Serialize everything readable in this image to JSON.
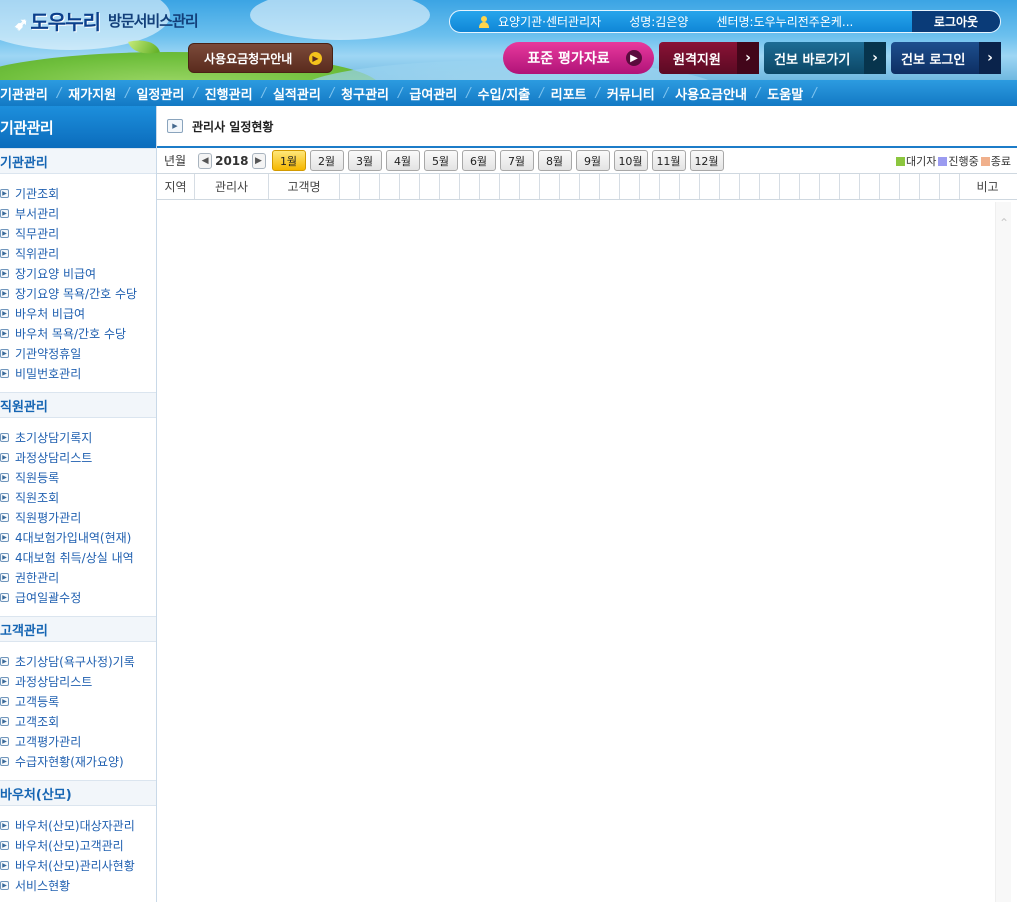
{
  "header": {
    "logo_text": "도우누리",
    "logo_sub": "방문서비스관리",
    "fee_guide_button": "사용요금청구안내",
    "user": {
      "org_type": "요양기관·센터관리자",
      "name_label": "성명:김은양",
      "center_label": "센터명:도우누리전주온케..."
    },
    "logout_label": "로그아웃",
    "standard_eval_button": "표준 평가자료",
    "remote_support_button": "원격지원",
    "health_insurance_button": "건보 바로가기",
    "health_login_button": "건보 로그인"
  },
  "nav": {
    "items": [
      "기관관리",
      "재가지원",
      "일정관리",
      "진행관리",
      "실적관리",
      "청구관리",
      "급여관리",
      "수입/지출",
      "리포트",
      "커뮤니티",
      "사용요금안내",
      "도움말"
    ]
  },
  "sidebar": {
    "title": "기관관리",
    "sections": [
      {
        "title": "기관관리",
        "items": [
          "기관조회",
          "부서관리",
          "직무관리",
          "직위관리",
          "장기요양 비급여",
          "장기요양 목욕/간호 수당",
          "바우처 비급여",
          "바우처 목욕/간호 수당",
          "기관약정휴일",
          "비밀번호관리"
        ]
      },
      {
        "title": "직원관리",
        "items": [
          "초기상담기록지",
          "과정상담리스트",
          "직원등록",
          "직원조회",
          "직원평가관리",
          "4대보험가입내역(현재)",
          "4대보험 취득/상실 내역",
          "권한관리",
          "급여일괄수정"
        ]
      },
      {
        "title": "고객관리",
        "items": [
          "초기상담(욕구사정)기록",
          "과정상담리스트",
          "고객등록",
          "고객조회",
          "고객평가관리",
          "수급자현황(재가요양)"
        ]
      },
      {
        "title": "바우처(산모)",
        "items": [
          "바우처(산모)대상자관리",
          "바우처(산모)고객관리",
          "바우처(산모)관리사현황",
          "서비스현황"
        ]
      }
    ]
  },
  "main": {
    "title": "관리사 일정현황",
    "year_month_label": "년월",
    "year": "2018",
    "months": [
      "1월",
      "2월",
      "3월",
      "4월",
      "5월",
      "6월",
      "7월",
      "8월",
      "9월",
      "10월",
      "11월",
      "12월"
    ],
    "active_month": "1월",
    "legend": [
      {
        "label": "대기자",
        "color": "#8cc63f"
      },
      {
        "label": "진행중",
        "color": "#9b9bf0"
      },
      {
        "label": "종료",
        "color": "#f0b08c"
      }
    ],
    "columns": {
      "region": "지역",
      "manager": "관리사",
      "customer": "고객명",
      "remarks": "비고"
    }
  },
  "colors": {
    "brand_blue": "#1379c4",
    "active_month": "#f5b700",
    "nav_blue": "#2c9be0"
  }
}
